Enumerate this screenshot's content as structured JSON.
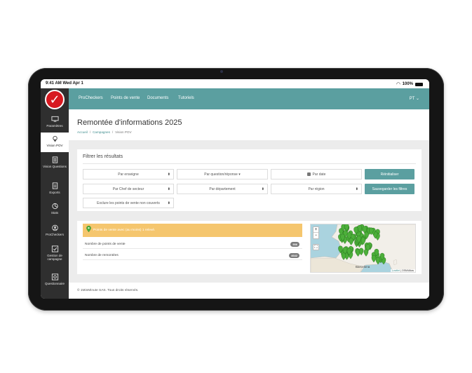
{
  "statusbar": {
    "time": "9:41 AM",
    "date": "Wed Apr 1",
    "battery": "100%",
    "battery_level": 1.0
  },
  "sidebar": {
    "items": [
      {
        "label": "Paramètres",
        "icon": "monitor-icon"
      },
      {
        "label": "Vision POV",
        "icon": "map-pin-icon",
        "active": true
      },
      {
        "label": "Vision Questions",
        "icon": "clipboard-icon"
      },
      {
        "label": "Exports",
        "icon": "document-icon"
      },
      {
        "label": "Stats",
        "icon": "pie-chart-icon"
      },
      {
        "label": "ProCheckers",
        "icon": "users-icon"
      },
      {
        "label": "Gestion de campagne",
        "icon": "checklist-icon"
      },
      {
        "label": "Questionnaire",
        "icon": "question-icon"
      }
    ]
  },
  "topnav": {
    "links": [
      "ProCheckers",
      "Points de vente",
      "Documents",
      "Tutoriels"
    ],
    "lang": "PT"
  },
  "header": {
    "title": "Remontée d'informations 2025",
    "breadcrumb": [
      "Accueil",
      "Campagnes",
      "Vision POV"
    ]
  },
  "filters": {
    "title": "Filtrer les résultats",
    "enseigne": "Par enseigne",
    "question": "Par question/réponse",
    "date": "Par date",
    "reset": "Réinitialiser",
    "chef": "Par Chef de secteur",
    "departement": "Par département",
    "region": "Par région",
    "save": "Sauvegarder les filtres",
    "exclude": "Exclure les points de vente non couverts"
  },
  "results": {
    "alert": "Points de vente avec (au moins) 1 relevé.",
    "rows": [
      {
        "label": "Nombre de points de vente",
        "count": "936"
      },
      {
        "label": "Nombre de remontées",
        "count": "4642"
      }
    ]
  },
  "map": {
    "zoom_in": "+",
    "zoom_out": "−",
    "fullscreen": "⛶",
    "city": "Barcelona",
    "attribution_leaflet": "Leaflet",
    "attribution_sep": " | ",
    "attribution_osm": "OSM/Atlas",
    "colors": {
      "land": "#f2efe9",
      "sea": "#aad3df",
      "marker": "#4caf3a"
    }
  },
  "footer": {
    "text": "© 1MinMinute SAS. Tous droits réservés."
  },
  "colors": {
    "accent": "#5b9fa0",
    "alert": "#f5c66e",
    "logo": "#d71920",
    "sidebar": "#2f2f2f"
  }
}
